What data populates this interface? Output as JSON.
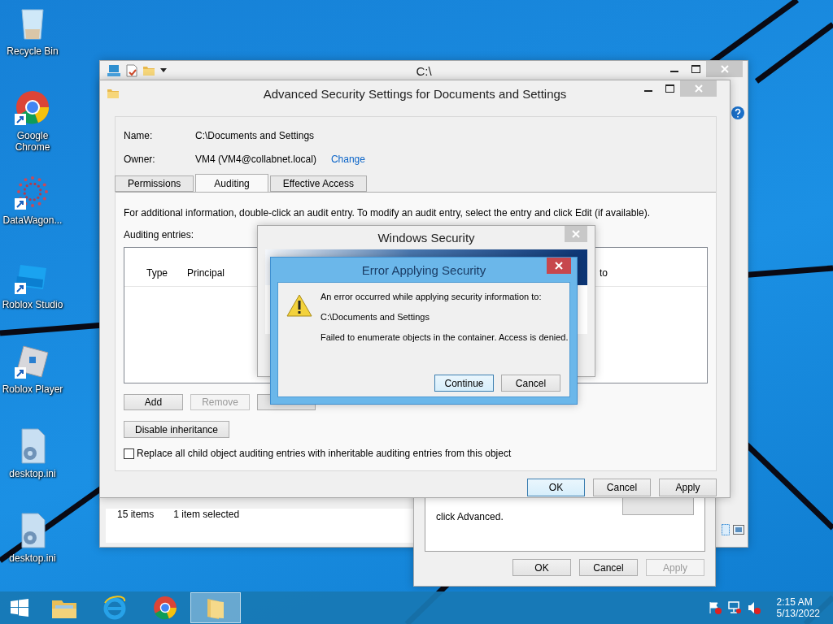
{
  "desktop_icons": [
    {
      "label": "Recycle Bin",
      "kind": "bin",
      "shortcut": false
    },
    {
      "label": "Google Chrome",
      "kind": "chrome",
      "shortcut": true
    },
    {
      "label": "DataWagon...",
      "kind": "dots",
      "shortcut": true
    },
    {
      "label": "Roblox Studio",
      "kind": "studio",
      "shortcut": true
    },
    {
      "label": "Roblox Player",
      "kind": "player",
      "shortcut": true
    },
    {
      "label": "desktop.ini",
      "kind": "ini",
      "shortcut": false
    },
    {
      "label": "desktop.ini",
      "kind": "ini",
      "shortcut": false
    }
  ],
  "explorer": {
    "title": "C:\\",
    "status_items": "15 items",
    "status_selected": "1 item selected"
  },
  "properties": {
    "text": "click Advanced.",
    "buttons": [
      {
        "label": "OK",
        "disabled": false
      },
      {
        "label": "Cancel",
        "disabled": false
      },
      {
        "label": "Apply",
        "disabled": true
      }
    ]
  },
  "advanced": {
    "title": "Advanced Security Settings for Documents and Settings",
    "name_label": "Name:",
    "name_value": "C:\\Documents and Settings",
    "owner_label": "Owner:",
    "owner_value": "VM4 (VM4@collabnet.local)",
    "owner_link": "Change",
    "tabs": [
      {
        "label": "Permissions",
        "selected": false
      },
      {
        "label": "Auditing",
        "selected": true
      },
      {
        "label": "Effective Access",
        "selected": false
      }
    ],
    "info": "For additional information, double-click an audit entry. To modify an audit entry, select the entry and click Edit (if available).",
    "entries_label": "Auditing entries:",
    "columns": [
      "Type",
      "Principal",
      "to"
    ],
    "entry_buttons": [
      {
        "label": "Add",
        "disabled": false
      },
      {
        "label": "Remove",
        "disabled": true
      }
    ],
    "inheritance_button": "Disable inheritance",
    "replace_checkbox": {
      "label": "Replace all child object auditing entries with inheritable auditing entries from this object",
      "checked": false
    },
    "buttons": [
      {
        "label": "OK",
        "default": true
      },
      {
        "label": "Cancel",
        "default": false
      },
      {
        "label": "Apply",
        "default": false
      }
    ]
  },
  "windows_security": {
    "title": "Windows Security"
  },
  "error_dialog": {
    "title": "Error Applying Security",
    "lines": [
      "An error occurred while applying security information to:",
      "C:\\Documents and Settings",
      "Failed to enumerate objects in the container. Access is denied."
    ],
    "buttons": [
      {
        "label": "Continue",
        "default": true
      },
      {
        "label": "Cancel",
        "default": false
      }
    ]
  },
  "taskbar": {
    "apps": [
      {
        "kind": "explorer",
        "active": false
      },
      {
        "kind": "ie",
        "active": false
      },
      {
        "kind": "chrome",
        "active": false
      },
      {
        "kind": "folder",
        "active": true
      }
    ],
    "time": "2:15 AM",
    "date": "5/13/2022"
  }
}
